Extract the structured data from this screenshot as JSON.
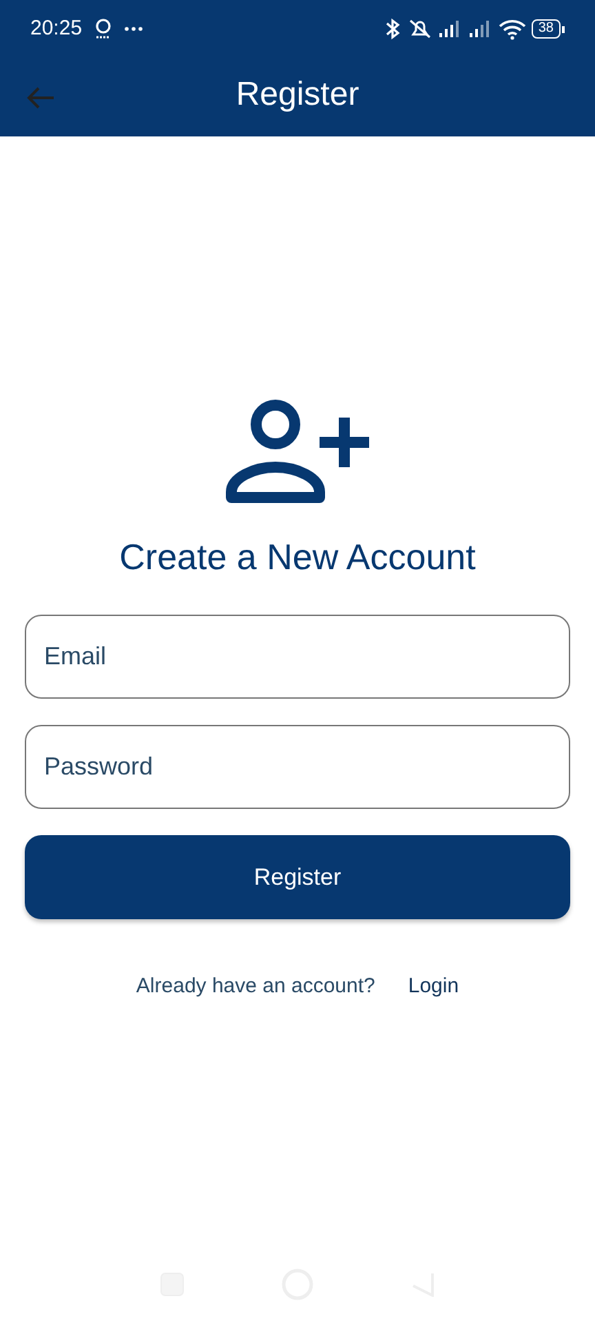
{
  "status_bar": {
    "time": "20:25",
    "battery": "38"
  },
  "app_bar": {
    "title": "Register"
  },
  "heading": "Create a New Account",
  "fields": [
    {
      "placeholder": "Email"
    },
    {
      "placeholder": "Password"
    }
  ],
  "submit_button": "Register",
  "footer": {
    "prompt": "Already have an account?",
    "link": "Login"
  }
}
